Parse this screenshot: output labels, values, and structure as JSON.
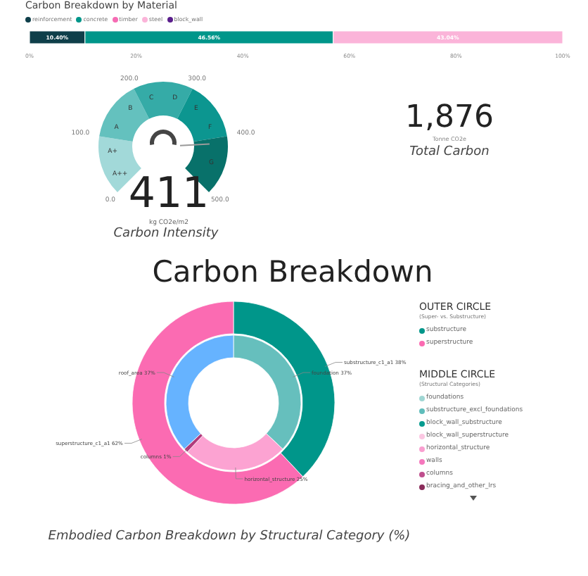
{
  "material_chart": {
    "title": "Carbon Breakdown by Material",
    "legend": [
      {
        "label": "reinforcement",
        "color": "#0f3f4a"
      },
      {
        "label": "concrete",
        "color": "#00968a"
      },
      {
        "label": "timber",
        "color": "#f66cb4"
      },
      {
        "label": "steel",
        "color": "#fbb4d9"
      },
      {
        "label": "block_wall",
        "color": "#5a1e8c"
      }
    ],
    "chart_data": {
      "type": "bar",
      "orientation": "horizontal",
      "stacked": true,
      "xlim": [
        0,
        100
      ],
      "xticks": [
        {
          "value": 0,
          "label": "0%"
        },
        {
          "value": 20,
          "label": "20%"
        },
        {
          "value": 40,
          "label": "40%"
        },
        {
          "value": 60,
          "label": "60%"
        },
        {
          "value": 80,
          "label": "80%"
        },
        {
          "value": 100,
          "label": "100%"
        }
      ],
      "series": [
        {
          "color": "#0f3f4a",
          "values": [
            10.4
          ],
          "value_labels": [
            "10.40%"
          ]
        },
        {
          "color": "#00968a",
          "values": [
            46.56
          ],
          "value_labels": [
            "46.56%"
          ]
        },
        {
          "color": "#fbb4d9",
          "values": [
            43.04
          ],
          "value_labels": [
            "43.04%"
          ]
        }
      ]
    }
  },
  "gauge": {
    "ticks": [
      "0.0",
      "100.0",
      "200.0",
      "300.0",
      "400.0",
      "500.0"
    ],
    "bands": [
      {
        "labels": [
          "A++",
          "A+"
        ],
        "color": "#a2d9d9"
      },
      {
        "labels": [
          "A",
          "B"
        ],
        "color": "#64c1be"
      },
      {
        "labels": [
          "C",
          "D"
        ],
        "color": "#35aba7"
      },
      {
        "labels": [
          "E",
          "F"
        ],
        "color": "#0c9690"
      },
      {
        "labels": [
          "G"
        ],
        "color": "#08716a"
      }
    ],
    "level": 0.822,
    "value": "411",
    "unit": "kg CO2e/m2",
    "title": "Carbon Intensity"
  },
  "total_carbon": {
    "value": "1,876",
    "unit": "Tonne CO2e",
    "title": "Total Carbon"
  },
  "breakdown": {
    "heading": "Carbon Breakdown",
    "outer_ring": {
      "chart_data": {
        "type": "donut",
        "values": [
          38,
          62
        ],
        "colors": [
          "#00968a",
          "#fb6bb2"
        ],
        "value_labels": [
          "substructure_c1_a1 38%",
          "superstructure_c1_a1 62%"
        ]
      }
    },
    "middle_ring": {
      "chart_data": {
        "type": "donut",
        "values": [
          37,
          25,
          1,
          37
        ],
        "colors": [
          "#66bfbd",
          "#fca3d2",
          "#b13b7c",
          "#66b3ff"
        ],
        "value_labels": [
          "foundation 37%",
          "horizontal_structure 25%",
          "columns 1%",
          "roof_area 37%"
        ]
      }
    },
    "caption": "Embodied Carbon Breakdown by Structural Category (%)",
    "legends": [
      {
        "title": "OUTER CIRCLE",
        "subtitle": "(Super- vs. Substructure)",
        "items": [
          {
            "label": "substructure",
            "color": "#00968a"
          },
          {
            "label": "superstructure",
            "color": "#fb6bb2"
          }
        ]
      },
      {
        "title": "MIDDLE CIRCLE",
        "subtitle": "(Structural Categories)",
        "items": [
          {
            "label": "foundations",
            "color": "#9fd6d3"
          },
          {
            "label": "substructure_excl_foundations",
            "color": "#5fbdbb"
          },
          {
            "label": "block_wall_substructure",
            "color": "#069b8f"
          },
          {
            "label": "block_wall_superstructure",
            "color": "#fbc7e2"
          },
          {
            "label": "horizontal_structure",
            "color": "#f99fd0"
          },
          {
            "label": "walls",
            "color": "#f577bd"
          },
          {
            "label": "columns",
            "color": "#bf4f8d"
          },
          {
            "label": "bracing_and_other_lrs",
            "color": "#8a2c5a"
          }
        ]
      }
    ]
  }
}
